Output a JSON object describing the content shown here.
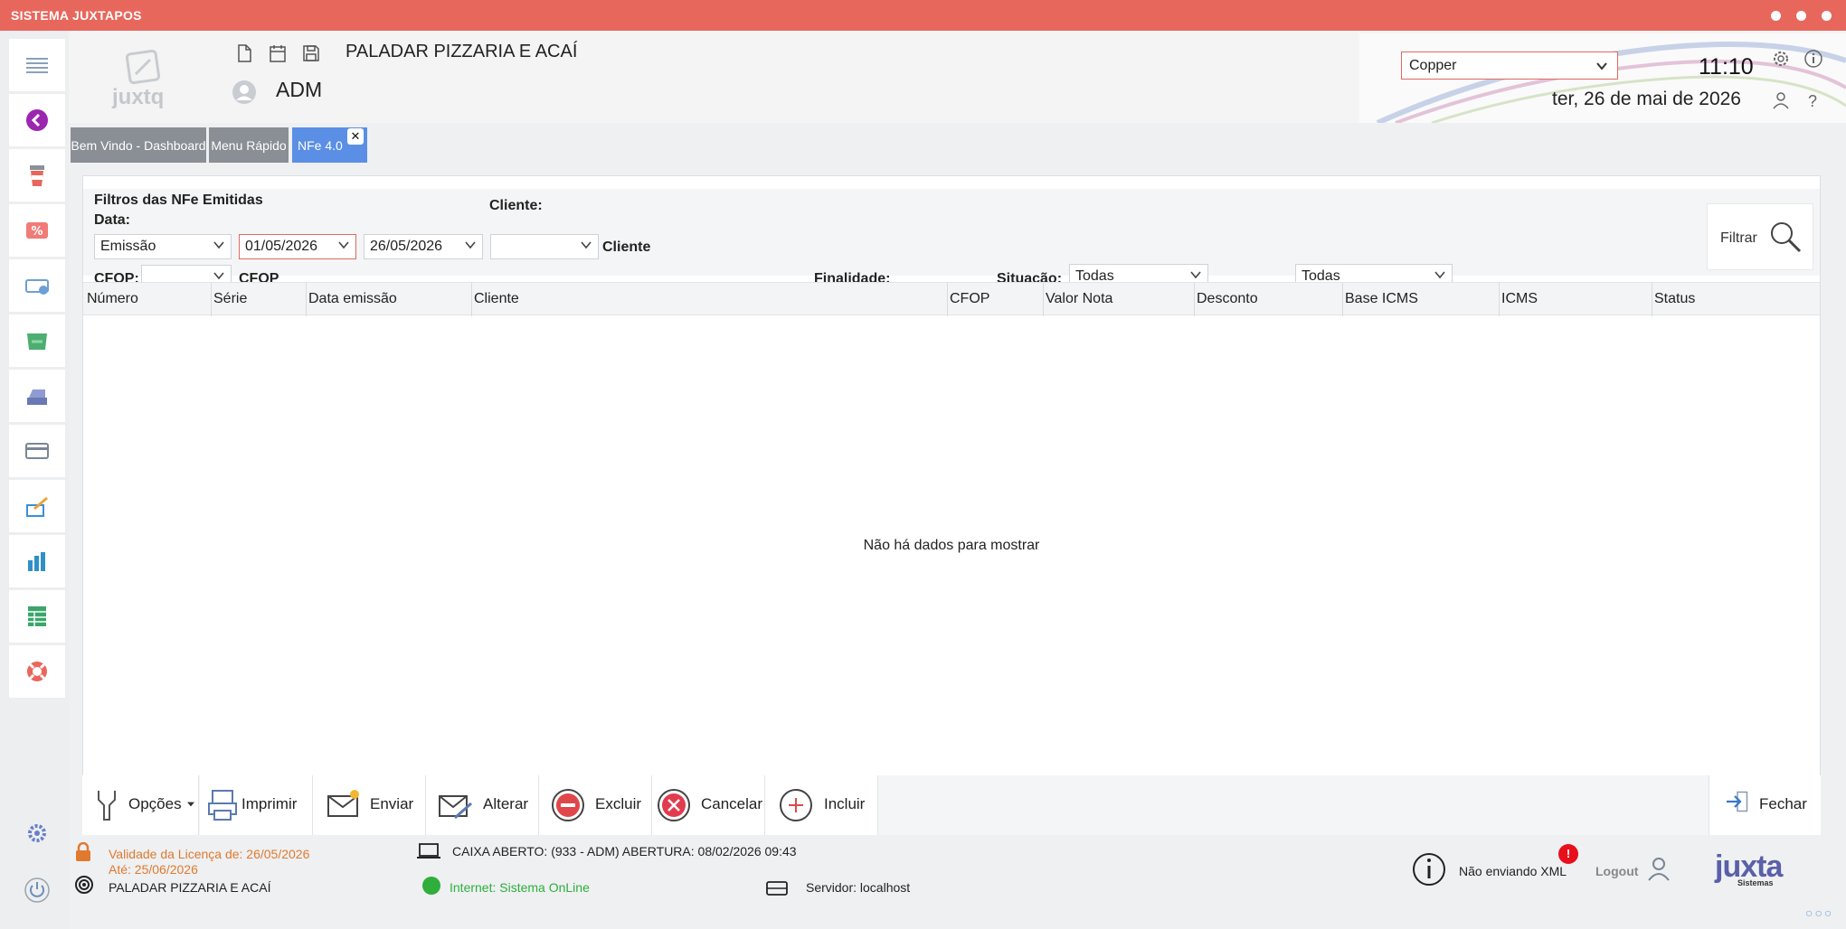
{
  "window": {
    "title": "SISTEMA JUXTAPOS"
  },
  "header": {
    "logo_text": "juxtq",
    "company": "PALADAR PIZZARIA E ACAÍ",
    "user": "ADM",
    "theme_value": "Copper",
    "time": "11:10",
    "date": "ter, 26 de mai de 2026",
    "help": "?"
  },
  "tabs": [
    {
      "label": "Bem Vindo - Dashboard"
    },
    {
      "label": "Menu Rápido"
    },
    {
      "label": "NFe 4.0",
      "close": "✕"
    }
  ],
  "filters": {
    "title": "Filtros das NFe Emitidas",
    "data_label": "Data:",
    "data_type": "Emissão",
    "date_from": "01/05/2026",
    "date_to": "26/05/2026",
    "cliente_label": "Cliente:",
    "cliente_value": "",
    "cliente_text": "Cliente",
    "cfop_label": "CFOP:",
    "cfop_value": "",
    "cfop_text": "CFOP",
    "finalidade_label": "Finalidade:",
    "situacao_label": "Situação:",
    "situacao_value": "Todas",
    "finalidade_value": "Todas",
    "filtrar_label": "Filtrar"
  },
  "table": {
    "columns": [
      "Número",
      "Série",
      "Data emissão",
      "Cliente",
      "CFOP",
      "Valor Nota",
      "Desconto",
      "Base ICMS",
      "ICMS",
      "Status"
    ],
    "empty_text": "Não há dados para mostrar"
  },
  "toolbar": {
    "opcoes": "Opções",
    "imprimir": "Imprimir",
    "enviar": "Enviar",
    "alterar": "Alterar",
    "excluir": "Excluir",
    "cancelar": "Cancelar",
    "incluir": "Incluir",
    "fechar": "Fechar"
  },
  "status": {
    "license_validity": "Validade da Licença de: 26/05/2026",
    "license_until": "Até: 25/06/2026",
    "company": "PALADAR PIZZARIA E ACAÍ",
    "caixa": "CAIXA ABERTO: (933 - ADM) ABERTURA: 08/02/2026 09:43",
    "internet": "Internet: Sistema OnLine",
    "servidor": "Servidor: localhost",
    "xml_status": "Não enviando XML",
    "xml_badge": "!",
    "logout": "Logout",
    "brand": "juxta",
    "brand_sub": "Sistemas"
  },
  "colors": {
    "titlebar": "#e8675c",
    "tab_active": "#5b8fe6",
    "tab_inactive": "#8a8f96",
    "license_orange": "#e07a2e",
    "online_green": "#2fae3c",
    "excluir_red": "#e0474a",
    "cancelar_red": "#e23b4e"
  }
}
